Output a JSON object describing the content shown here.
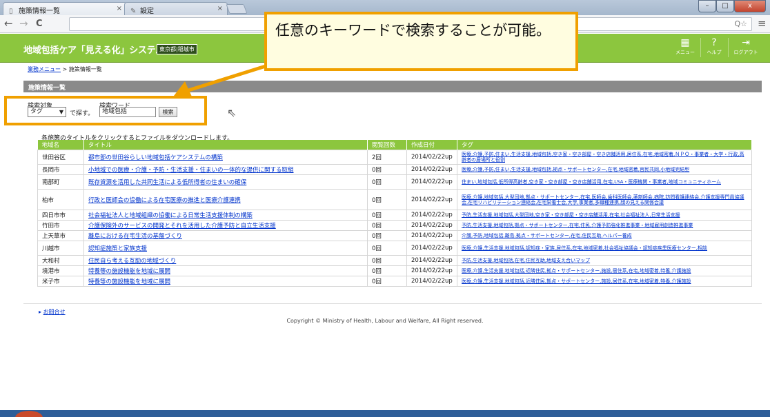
{
  "browser": {
    "tabs": [
      {
        "title": "施策情報一覧",
        "active": true
      },
      {
        "title": "設定",
        "active": false
      }
    ],
    "nav": {
      "back": "←",
      "forward": "→",
      "reload": "C",
      "menu": "≡",
      "zoom": "Q☆"
    }
  },
  "window_controls": {
    "minimize": "–",
    "maximize": "□",
    "close": "x"
  },
  "header": {
    "app_title": "地域包括ケア「見える化」システム",
    "badge": "東京都|稲城市",
    "buttons": [
      {
        "label": "メニュー",
        "icon": "grid-icon"
      },
      {
        "label": "ヘルプ",
        "icon": "help-icon"
      },
      {
        "label": "ログアウト",
        "icon": "logout-icon"
      }
    ]
  },
  "breadcrumb": {
    "home": "業務メニュー",
    "separator": ">",
    "current": "施策情報一覧"
  },
  "section_title": "施策情報一覧",
  "search": {
    "target_label": "検索対象",
    "target_value": "タグ",
    "suffix": "で探す。",
    "word_label": "検索ワード",
    "word_value": "地域包括",
    "button": "検索"
  },
  "callout": {
    "text": "任意のキーワードで検索することが可能。"
  },
  "intro_text": "各施策のタイトルをクリックするとファイルをダウンロードします。",
  "table": {
    "columns": [
      "地域名",
      "タイトル",
      "閲覧回数",
      "作成日付",
      "タグ"
    ],
    "rows": [
      {
        "area": "世田谷区",
        "title": "都市部の世田谷らしい地域包括ケアシステムの構築",
        "views": "2回",
        "date": "2014/02/22up",
        "tags": "医療,介護,予防,住まい,生活支援,地域包括,空き家・空き部屋・空き店舗活用,居住系,在宅,地域密着,ＮＰＯ・事業者・大学・行政,高齢者の居場所と役割"
      },
      {
        "area": "長岡市",
        "title": "小地域での医療・介護・予防・生活支援・住まいの一体的な提供に関する取組",
        "views": "0回",
        "date": "2014/02/22up",
        "tags": "医療,介護,予防,住まい,生活支援,地域包括,拠点・サポートセンター,在宅,地域密着,官民共同,小地域完結型"
      },
      {
        "area": "南部町",
        "title": "既存資源を活用した共同生活による低所得者の住まいの確保",
        "views": "0回",
        "date": "2014/02/22up",
        "tags": "住まい,地域包括,低所得高齢者,空き家・空き部屋・空き店舗活用,在宅,LSA・医療機関・事業者,地域コミュニティホーム"
      },
      {
        "area": "柏市",
        "title": "行政と医師会の協働による在宅医療の推進と医療介護連携",
        "views": "0回",
        "date": "2014/02/22up",
        "tags": "医療,介護,地域包括,大型団地,拠点・サポートセンター,在宅,医師会,歯科医師会,薬剤師会,病院,訪問看護連絡会,介護支援専門員協議会,在宅リハビリテーション連絡会,在宅栄養士会,大学,事業者,多職種連携,顔の見える関係会議"
      },
      {
        "area": "四日市市",
        "title": "社会福祉法人と地域組織の協働による日常生活支援体制の構築",
        "views": "0回",
        "date": "2014/02/22up",
        "tags": "予防,生活支援,地域包括,大型団地,空き家・空き部屋・空き店舗活用,在宅,社会福祉法人,日常生活支援"
      },
      {
        "area": "竹田市",
        "title": "介護保険外のサービスの開発とそれを活用した介護予防と自立生活支援",
        "views": "0回",
        "date": "2014/02/22up",
        "tags": "予防,生活支援,地域包括,拠点・サポートセンター,在宅,住民,介護予防強化推進事業・地域雇用創造推進事業"
      },
      {
        "area": "上天草市",
        "title": "離島における在宅生活の基盤づくり",
        "views": "0回",
        "date": "2014/02/22up",
        "tags": "介護,予防,地域包括,離島,拠点・サポートセンター,在宅,住民互助,ヘルパー養成"
      },
      {
        "area": "川越市",
        "title": "認知症施策と家族支援",
        "views": "0回",
        "date": "2014/02/22up",
        "tags": "医療,介護,生活支援,地域包括,認知症・家族,居住系,在宅,地域密着,社会福祉協議会・認知症疾患医療センター,相談"
      },
      {
        "area": "大和村",
        "title": "住民自ら考える互助の地域づくり",
        "views": "0回",
        "date": "2014/02/22up",
        "tags": "予防,生活支援,地域包括,在宅,住民互助,地域支え合いマップ"
      },
      {
        "area": "境港市",
        "title": "特養等の施設機能を地域に展開",
        "views": "0回",
        "date": "2014/02/22up",
        "tags": "医療,介護,生活支援,地域包括,近隣住民,拠点・サポートセンター,施設,居住系,在宅,地域密着,特養,介護施設"
      },
      {
        "area": "米子市",
        "title": "特養等の施設機能を地域に展開",
        "views": "0回",
        "date": "2014/02/22up",
        "tags": "医療,介護,生活支援,地域包括,近隣住民,拠点・サポートセンター,施設,居住系,在宅,地域密着,特養,介護施設"
      }
    ]
  },
  "footer": {
    "contact": "お問合せ",
    "copyright": "Copyright © Ministry of Health, Labour and Welfare, All Right reserved."
  },
  "colors": {
    "header": "#8cc63e",
    "callout_border": "#f0a000",
    "link": "#0033cc",
    "section_bar": "#8a8a8a"
  }
}
